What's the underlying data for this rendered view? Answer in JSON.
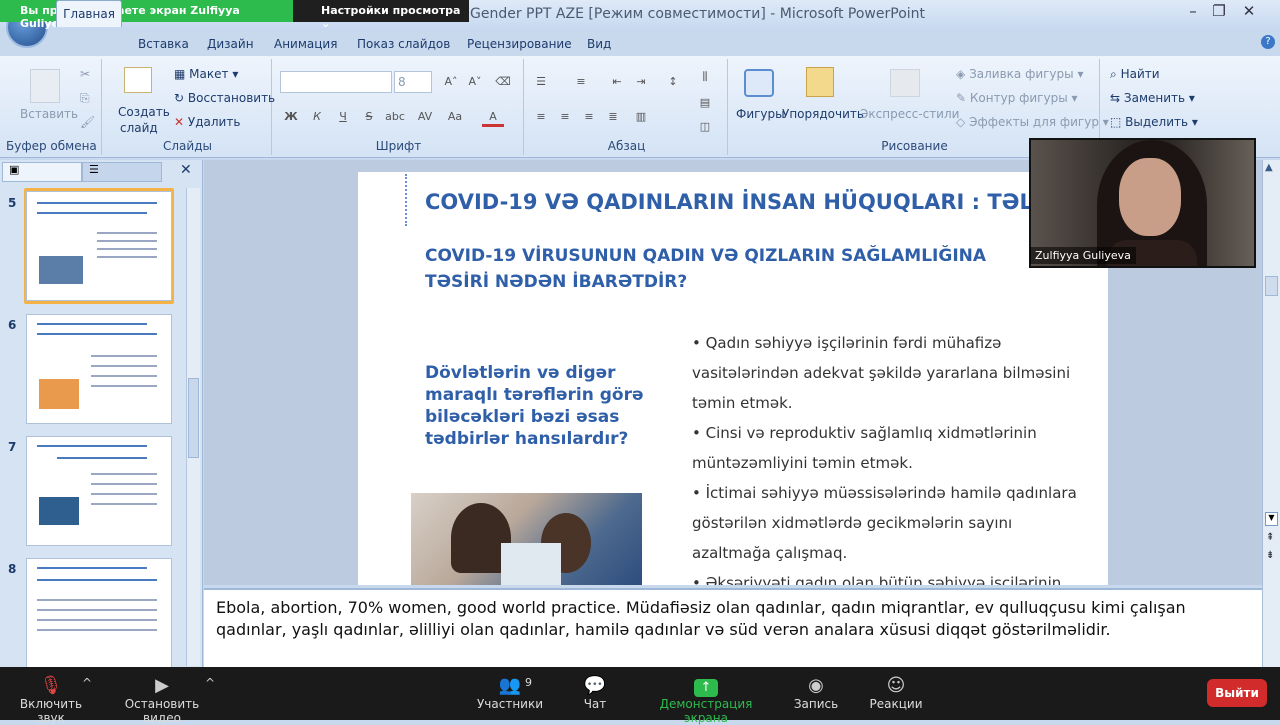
{
  "window": {
    "title": "Gender PPT AZE [Режим совместимости] - Microsoft PowerPoint"
  },
  "zoom_banner": {
    "sharing_text": "Вы просматриваете экран Zulfiyya Guliyeva",
    "view_options": "Настройки просмотра"
  },
  "tabs": [
    "Главная",
    "Вставка",
    "Дизайн",
    "Анимация",
    "Показ слайдов",
    "Рецензирование",
    "Вид"
  ],
  "ribbon": {
    "clipboard": {
      "paste": "Вставить",
      "label": "Буфер обмена"
    },
    "slides": {
      "new_slide_1": "Создать",
      "new_slide_2": "слайд",
      "layout": "Макет",
      "reset": "Восстановить",
      "delete": "Удалить",
      "label": "Слайды"
    },
    "font": {
      "size": "8",
      "label": "Шрифт",
      "bold": "Ж",
      "italic": "К",
      "underline": "Ч",
      "strike": "S"
    },
    "paragraph": {
      "label": "Абзац"
    },
    "drawing": {
      "shapes": "Фигуры",
      "arrange": "Упорядочить",
      "quick_styles": "Экспресс-стили",
      "fill": "Заливка фигуры",
      "outline": "Контур фигуры",
      "effects": "Эффекты для фигур",
      "label": "Рисование"
    },
    "editing": {
      "find": "Найти",
      "replace": "Заменить",
      "select": "Выделить"
    }
  },
  "thumbnails": [
    {
      "num": "5"
    },
    {
      "num": "6"
    },
    {
      "num": "7"
    },
    {
      "num": "8"
    }
  ],
  "slide": {
    "title": "COVID-19 VƏ QADINLARIN İNSAN HÜQUQLARI : TƏLIMAT",
    "subtitle": "COVID-19 VİRUSUNUN QADIN VƏ QIZLARIN SAĞLAMLIĞINA TƏSİRİ NƏDƏN İBARƏTDİR?",
    "question": "Dövlətlərin və digər maraqlı tərəflərin görə biləcəkləri bəzi əsas tədbirlər hansılardır?",
    "bullets": [
      "•  Qadın səhiyyə işçilərinin fərdi mühafizə vasitələrindən adekvat şəkildə yararlana bilməsini təmin etmək.",
      "•  Cinsi və reproduktiv sağlamlıq xidmətlərinin müntəzəmliyini təmin etmək.",
      "• İctimai səhiyyə müəssisələrində hamilə qadınlara göstərilən xidmətlərdə gecikmələrin sayını azaltmağa çalışmaq.",
      "• Əksəriyyəti qadın olan bütün səhiyyə işçilərinin"
    ]
  },
  "notes": "Ebola, abortion, 70% women, good world practice. Müdafiəsiz olan qadınlar, qadın miqrantlar, ev qulluqçusu kimi çalışan qadınlar, yaşlı qadınlar, əlilliyi olan qadınlar, hamilə qadınlar və süd verən analara xüsusi diqqət göstərilməlidir.",
  "video": {
    "name": "Zulfiyya Guliyeva"
  },
  "zoom": {
    "mute": "Включить звук",
    "video": "Остановить видео",
    "participants": "Участники",
    "participants_count": "9",
    "chat": "Чат",
    "share": "Демонстрация экрана",
    "record": "Запись",
    "reactions": "Реакции",
    "leave": "Выйти"
  }
}
